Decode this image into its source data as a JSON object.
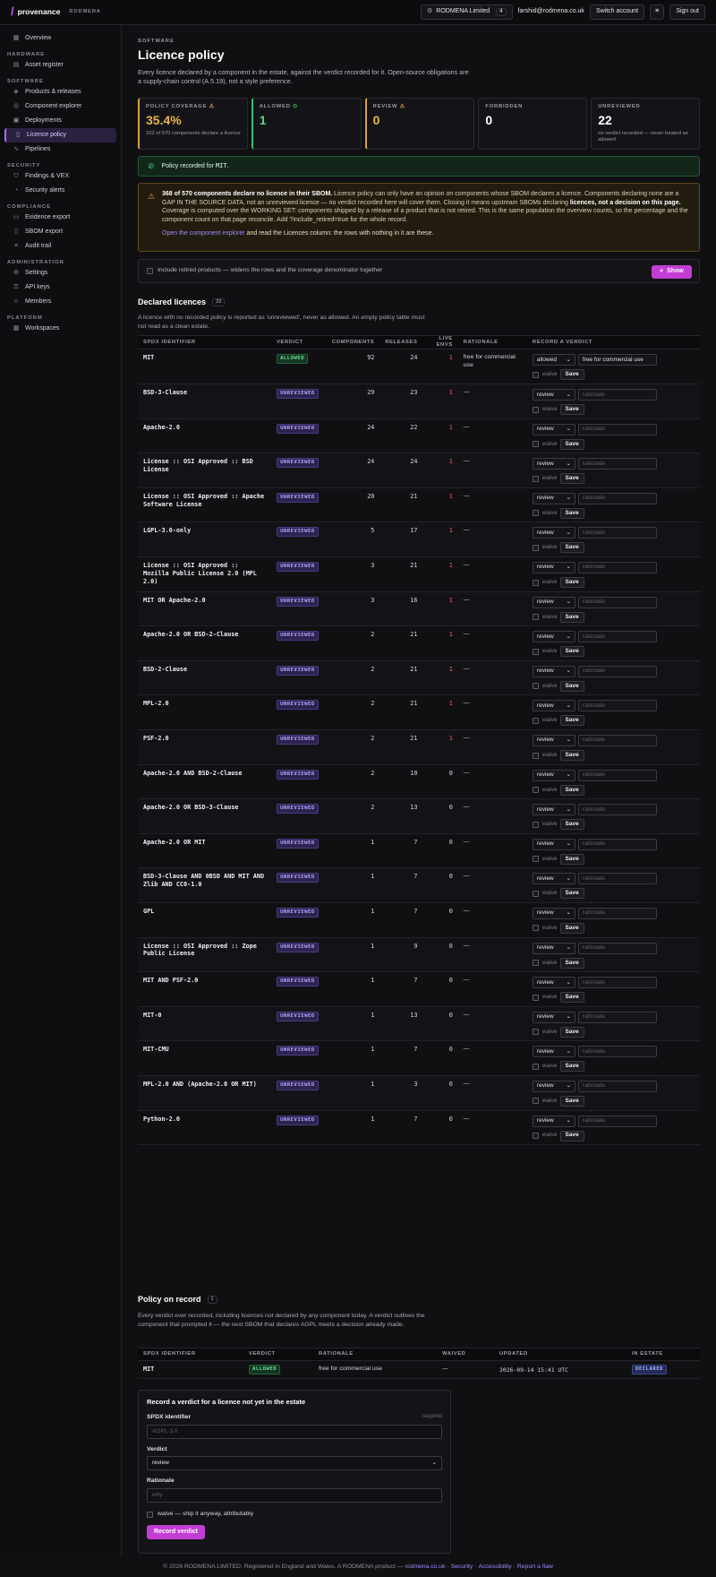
{
  "topbar": {
    "brand": "provenance",
    "org": "RODMENA",
    "account": "RODMENA Limited",
    "account_count": "4",
    "user": "farshid@rodmena.co.uk",
    "switch": "Switch account",
    "signout": "Sign out"
  },
  "sidebar": {
    "overview": "Overview",
    "sec_hardware": "HARDWARE",
    "asset_register": "Asset register",
    "sec_software": "SOFTWARE",
    "products": "Products & releases",
    "explorer": "Component explorer",
    "deployments": "Deployments",
    "licence_policy": "Licence policy",
    "pipelines": "Pipelines",
    "sec_security": "SECURITY",
    "findings": "Findings & VEX",
    "alerts": "Security alerts",
    "sec_compliance": "COMPLIANCE",
    "evidence": "Evidence export",
    "sbom": "SBOM export",
    "audit": "Audit trail",
    "sec_admin": "ADMINISTRATION",
    "settings": "Settings",
    "api_keys": "API keys",
    "members": "Members",
    "sec_platform": "PLATFORM",
    "workspaces": "Workspaces"
  },
  "header": {
    "section": "SOFTWARE",
    "title": "Licence policy",
    "lead": "Every licence declared by a component in the estate, against the verdict recorded for it. Open-source obligations are a supply-chain control (A.5.19), not a style preference."
  },
  "cards": {
    "coverage_label": "POLICY COVERAGE",
    "coverage_value": "35.4%",
    "coverage_sub": "202 of 570 components declare a licence",
    "allowed_label": "ALLOWED",
    "allowed_value": "1",
    "review_label": "REVIEW",
    "review_value": "0",
    "forbidden_label": "FORBIDDEN",
    "forbidden_value": "0",
    "unreviewed_label": "UNREVIEWED",
    "unreviewed_value": "22",
    "unreviewed_sub": "no verdict recorded — never treated as allowed"
  },
  "banner_ok": {
    "prefix": "Policy recorded for ",
    "licence": "MIT",
    "suffix": "."
  },
  "banner_warn": {
    "bold": "368 of 570 components declare no licence in their SBOM.",
    "text1": " Licence policy can only have an opinion on components whose SBOM declares a licence. Components declaring none are a GAP IN THE SOURCE DATA, not an unreviewed licence — no verdict recorded here will cover them. Closing it means upstream SBOMs declaring ",
    "bold2": "licences, not a decision on this page.",
    "text2": " Coverage is computed over the WORKING SET: components shipped by a release of a product that is not retired. This is the same population the overview counts, so the percentage and the component count on that page reconcile. Add ?include_retired=true for the whole record.",
    "link": "Open the component explorer",
    "link_tail": " and read the Licences column: the rows with nothing in it are these."
  },
  "include_retired": {
    "label": "Include retired products — widens the rows and the coverage denominator together",
    "button": "Show"
  },
  "declared": {
    "title": "Declared licences",
    "count": "23",
    "desc": "A licence with no recorded policy is reported as 'unreviewed', never as allowed. An empty policy table must not read as a clean estate.",
    "columns": [
      "SPDX IDENTIFIER",
      "VERDICT",
      "COMPONENTS",
      "RELEASES",
      "LIVE ENVS",
      "RATIONALE",
      "RECORD A VERDICT"
    ],
    "rows": [
      {
        "spdx": "MIT",
        "verdict": "ALLOWED",
        "components": "92",
        "releases": "24",
        "live": "1",
        "rationale": "free for commercial use",
        "select": "allowed",
        "input": "free for commercial use"
      },
      {
        "spdx": "BSD-3-Clause",
        "verdict": "UNREVIEWED",
        "components": "29",
        "releases": "23",
        "live": "1",
        "rationale": "—",
        "select": "review",
        "input": "rationale"
      },
      {
        "spdx": "Apache-2.0",
        "verdict": "UNREVIEWED",
        "components": "24",
        "releases": "22",
        "live": "1",
        "rationale": "—",
        "select": "review",
        "input": "rationale"
      },
      {
        "spdx": "License :: OSI Approved :: BSD License",
        "verdict": "UNREVIEWED",
        "components": "24",
        "releases": "24",
        "live": "1",
        "rationale": "—",
        "select": "review",
        "input": "rationale"
      },
      {
        "spdx": "License :: OSI Approved :: Apache Software License",
        "verdict": "UNREVIEWED",
        "components": "20",
        "releases": "21",
        "live": "1",
        "rationale": "—",
        "select": "review",
        "input": "rationale"
      },
      {
        "spdx": "LGPL-3.0-only",
        "verdict": "UNREVIEWED",
        "components": "5",
        "releases": "17",
        "live": "1",
        "rationale": "—",
        "select": "review",
        "input": "rationale"
      },
      {
        "spdx": "License :: OSI Approved :: Mozilla Public License 2.0 (MPL 2.0)",
        "verdict": "UNREVIEWED",
        "components": "3",
        "releases": "21",
        "live": "1",
        "rationale": "—",
        "select": "review",
        "input": "rationale"
      },
      {
        "spdx": "MIT OR Apache-2.0",
        "verdict": "UNREVIEWED",
        "components": "3",
        "releases": "16",
        "live": "1",
        "rationale": "—",
        "select": "review",
        "input": "rationale"
      },
      {
        "spdx": "Apache-2.0 OR BSD-2-Clause",
        "verdict": "UNREVIEWED",
        "components": "2",
        "releases": "21",
        "live": "1",
        "rationale": "—",
        "select": "review",
        "input": "rationale"
      },
      {
        "spdx": "BSD-2-Clause",
        "verdict": "UNREVIEWED",
        "components": "2",
        "releases": "21",
        "live": "1",
        "rationale": "—",
        "select": "review",
        "input": "rationale"
      },
      {
        "spdx": "MPL-2.0",
        "verdict": "UNREVIEWED",
        "components": "2",
        "releases": "21",
        "live": "1",
        "rationale": "—",
        "select": "review",
        "input": "rationale"
      },
      {
        "spdx": "PSF-2.0",
        "verdict": "UNREVIEWED",
        "components": "2",
        "releases": "21",
        "live": "1",
        "rationale": "—",
        "select": "review",
        "input": "rationale"
      },
      {
        "spdx": "Apache-2.0 AND BSD-2-Clause",
        "verdict": "UNREVIEWED",
        "components": "2",
        "releases": "10",
        "live": "0",
        "rationale": "—",
        "select": "review",
        "input": "rationale"
      },
      {
        "spdx": "Apache-2.0 OR BSD-3-Clause",
        "verdict": "UNREVIEWED",
        "components": "2",
        "releases": "13",
        "live": "0",
        "rationale": "—",
        "select": "review",
        "input": "rationale"
      },
      {
        "spdx": "Apache-2.0 OR MIT",
        "verdict": "UNREVIEWED",
        "components": "1",
        "releases": "7",
        "live": "0",
        "rationale": "—",
        "select": "review",
        "input": "rationale"
      },
      {
        "spdx": "BSD-3-Clause AND 0BSD AND MIT AND Zlib AND CC0-1.0",
        "verdict": "UNREVIEWED",
        "components": "1",
        "releases": "7",
        "live": "0",
        "rationale": "—",
        "select": "review",
        "input": "rationale"
      },
      {
        "spdx": "GPL",
        "verdict": "UNREVIEWED",
        "components": "1",
        "releases": "7",
        "live": "0",
        "rationale": "—",
        "select": "review",
        "input": "rationale"
      },
      {
        "spdx": "License :: OSI Approved :: Zope Public License",
        "verdict": "UNREVIEWED",
        "components": "1",
        "releases": "9",
        "live": "0",
        "rationale": "—",
        "select": "review",
        "input": "rationale"
      },
      {
        "spdx": "MIT AND PSF-2.0",
        "verdict": "UNREVIEWED",
        "components": "1",
        "releases": "7",
        "live": "0",
        "rationale": "—",
        "select": "review",
        "input": "rationale"
      },
      {
        "spdx": "MIT-0",
        "verdict": "UNREVIEWED",
        "components": "1",
        "releases": "13",
        "live": "0",
        "rationale": "—",
        "select": "review",
        "input": "rationale"
      },
      {
        "spdx": "MIT-CMU",
        "verdict": "UNREVIEWED",
        "components": "1",
        "releases": "7",
        "live": "0",
        "rationale": "—",
        "select": "review",
        "input": "rationale"
      },
      {
        "spdx": "MPL-2.0 AND (Apache-2.0 OR MIT)",
        "verdict": "UNREVIEWED",
        "components": "1",
        "releases": "3",
        "live": "0",
        "rationale": "—",
        "select": "review",
        "input": "rationale"
      },
      {
        "spdx": "Python-2.0",
        "verdict": "UNREVIEWED",
        "components": "1",
        "releases": "7",
        "live": "0",
        "rationale": "—",
        "select": "review",
        "input": "rationale"
      }
    ],
    "waive": "waive",
    "save": "Save"
  },
  "record": {
    "title": "Policy on record",
    "count": "1",
    "desc": "Every verdict ever recorded, including licences not declared by any component today. A verdict outlives the component that prompted it — the next SBOM that declares AGPL meets a decision already made.",
    "columns": [
      "SPDX IDENTIFIER",
      "VERDICT",
      "RATIONALE",
      "WAIVED",
      "UPDATED",
      "IN ESTATE"
    ],
    "row": {
      "spdx": "MIT",
      "verdict": "ALLOWED",
      "rationale": "free for commercial use",
      "waived": "—",
      "updated": "2026-09-14 15:41 UTC",
      "estate": "DECLARED"
    }
  },
  "form": {
    "title": "Record a verdict for a licence not yet in the estate",
    "spdx_label": "SPDX identifier",
    "required": "required",
    "spdx_placeholder": "AGPL-3.0",
    "verdict_label": "Verdict",
    "verdict_value": "review",
    "rationale_label": "Rationale",
    "rationale_placeholder": "why",
    "waive_label": "waive — ship it anyway, attributably",
    "submit": "Record verdict"
  },
  "footer": {
    "text": "© 2026 RODMENA LIMITED. Registered in England and Wales. A RODMENA product —",
    "site": "rodmena.co.uk",
    "security": "Security",
    "accessibility": "Accessibility",
    "report": "Report a flaw"
  },
  "colors": {
    "accent": "#c23dd3",
    "allowed": "#39c06a",
    "warning": "#d4a43a",
    "unreviewed": "#b8a4ff"
  }
}
